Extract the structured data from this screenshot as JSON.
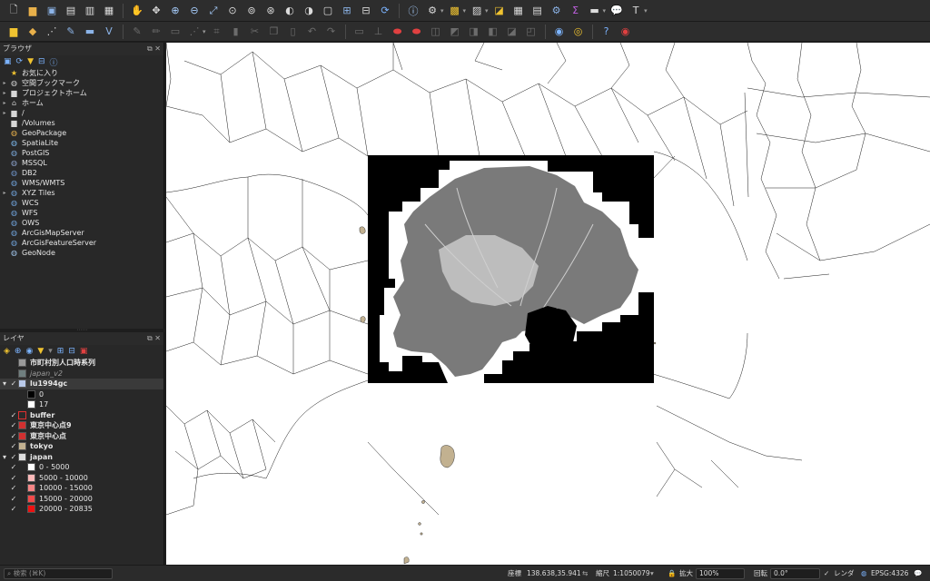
{
  "browser_panel": {
    "title": "ブラウザ",
    "items": [
      {
        "label": "お気に入り",
        "icon": "star-icon",
        "color": "#f0c330",
        "arrow": ""
      },
      {
        "label": "空間ブックマーク",
        "icon": "bookmark-icon",
        "color": "#d0d0d0",
        "arrow": "▸"
      },
      {
        "label": "プロジェクトホーム",
        "icon": "folder-icon",
        "color": "#d7d7d7",
        "arrow": "▸"
      },
      {
        "label": "ホーム",
        "icon": "home-icon",
        "color": "#d0d0d0",
        "arrow": "▸"
      },
      {
        "label": "/",
        "icon": "folder-icon",
        "color": "#d7d7d7",
        "arrow": "▸"
      },
      {
        "label": "/Volumes",
        "icon": "folder-icon",
        "color": "#d7d7d7",
        "arrow": ""
      },
      {
        "label": "GeoPackage",
        "icon": "geopackage-icon",
        "color": "#e8b04a",
        "arrow": ""
      },
      {
        "label": "SpatiaLite",
        "icon": "spatialite-icon",
        "color": "#7bb6ea",
        "arrow": ""
      },
      {
        "label": "PostGIS",
        "icon": "postgis-icon",
        "color": "#7aa7d8",
        "arrow": ""
      },
      {
        "label": "MSSQL",
        "icon": "mssql-icon",
        "color": "#8a9fc8",
        "arrow": ""
      },
      {
        "label": "DB2",
        "icon": "db2-icon",
        "color": "#6e92c6",
        "arrow": ""
      },
      {
        "label": "WMS/WMTS",
        "icon": "wms-icon",
        "color": "#6fa1d8",
        "arrow": ""
      },
      {
        "label": "XYZ Tiles",
        "icon": "xyz-icon",
        "color": "#6fa1d8",
        "arrow": "▸"
      },
      {
        "label": "WCS",
        "icon": "wcs-icon",
        "color": "#6fa1d8",
        "arrow": ""
      },
      {
        "label": "WFS",
        "icon": "wfs-icon",
        "color": "#6fa1d8",
        "arrow": ""
      },
      {
        "label": "OWS",
        "icon": "ows-icon",
        "color": "#6fa1d8",
        "arrow": ""
      },
      {
        "label": "ArcGisMapServer",
        "icon": "arcgis-map-icon",
        "color": "#6fa1d8",
        "arrow": ""
      },
      {
        "label": "ArcGisFeatureServer",
        "icon": "arcgis-feature-icon",
        "color": "#6fa1d8",
        "arrow": ""
      },
      {
        "label": "GeoNode",
        "icon": "geonode-icon",
        "color": "#9fc3e8",
        "arrow": ""
      }
    ]
  },
  "layers_panel": {
    "title": "レイヤ",
    "layers": [
      {
        "label": "市町村別人口時系列",
        "check": "",
        "arrow": "",
        "swatch": "#9a9a9a",
        "style": "bold"
      },
      {
        "label": "japan_v2",
        "check": "",
        "arrow": "",
        "swatch": "#6f7f7f",
        "style": "italic"
      },
      {
        "label": "lu1994gc",
        "check": "✓",
        "arrow": "▾",
        "swatch": "#b9c9e9",
        "style": "bold sel"
      },
      {
        "label": "0",
        "check": "",
        "arrow": "",
        "swatch": "#000000",
        "style": "legend"
      },
      {
        "label": "17",
        "check": "",
        "arrow": "",
        "swatch": "#ffffff",
        "style": "legend"
      },
      {
        "label": "buffer",
        "check": "✓",
        "arrow": "",
        "swatch": "#2a2a2a",
        "style": "bold"
      },
      {
        "label": "東京中心点9",
        "check": "✓",
        "arrow": "",
        "swatch": "#d03030",
        "style": "bold"
      },
      {
        "label": "東京中心点",
        "check": "✓",
        "arrow": "",
        "swatch": "#d03030",
        "style": "bold"
      },
      {
        "label": "tokyo",
        "check": "✓",
        "arrow": "",
        "swatch": "#c2b190",
        "style": "bold"
      },
      {
        "label": "japan",
        "check": "✓",
        "arrow": "▾",
        "swatch": "#dddddd",
        "style": "bold"
      },
      {
        "label": "0 - 5000",
        "check": "✓",
        "arrow": "",
        "swatch": "#ffffff",
        "style": "legend"
      },
      {
        "label": "5000 - 10000",
        "check": "✓",
        "arrow": "",
        "swatch": "#fbb9b9",
        "style": "legend"
      },
      {
        "label": "10000 - 15000",
        "check": "✓",
        "arrow": "",
        "swatch": "#f78585",
        "style": "legend"
      },
      {
        "label": "15000 - 20000",
        "check": "✓",
        "arrow": "",
        "swatch": "#f24a4a",
        "style": "legend"
      },
      {
        "label": "20000 - 20835",
        "check": "✓",
        "arrow": "",
        "swatch": "#ee1111",
        "style": "legend"
      }
    ]
  },
  "statusbar": {
    "search_placeholder": "検索 (⌘K)",
    "coord_label": "座標",
    "coord_value": "138.638,35.941",
    "scale_label": "縮尺",
    "scale_value": "1:1050079",
    "magnifier_label": "拡大",
    "magnifier_value": "100%",
    "rotation_label": "回転",
    "rotation_value": "0.0°",
    "render_label": "レンダ",
    "crs_label": "EPSG:4326"
  },
  "map": {
    "background_color": "#ffffff",
    "boundary_color": "#000000",
    "raster_background": "#000000",
    "raster_land": "#777777",
    "island_color": "#c2b190"
  }
}
